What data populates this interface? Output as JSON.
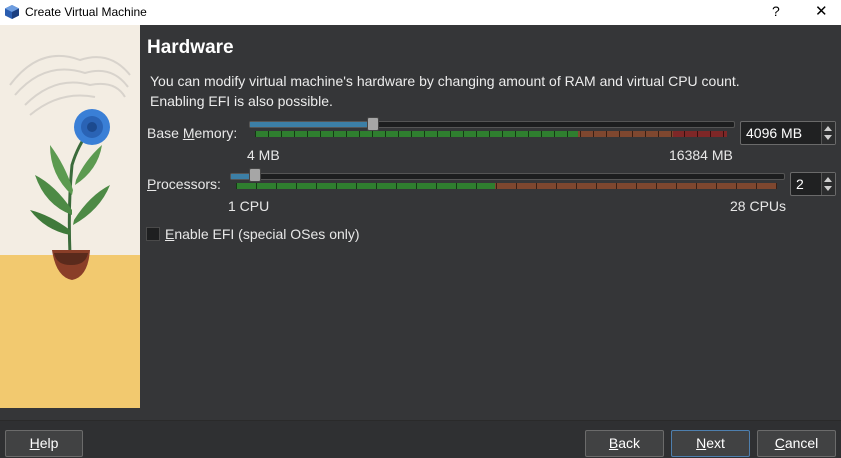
{
  "window": {
    "title": "Create Virtual Machine",
    "help_glyph": "?",
    "close_glyph": "✕"
  },
  "page": {
    "heading": "Hardware",
    "description": "You can modify virtual machine's hardware by changing amount of RAM and virtual CPU count. Enabling EFI is also possible."
  },
  "memory": {
    "label_pre": "Base ",
    "label_accel": "M",
    "label_post": "emory:",
    "min_label": "4 MB",
    "max_label": "16384 MB",
    "value_text": "4096 MB",
    "value": 4096,
    "min": 4,
    "max": 16384
  },
  "processors": {
    "label_accel": "P",
    "label_post": "rocessors:",
    "min_label": "1 CPU",
    "max_label": "28 CPUs",
    "value_text": "2",
    "value": 2,
    "min": 1,
    "max": 28
  },
  "efi": {
    "label_accel": "E",
    "label_post": "nable EFI (special OSes only)",
    "checked": false
  },
  "buttons": {
    "help_accel": "H",
    "help_post": "elp",
    "back_accel": "B",
    "back_post": "ack",
    "next_accel": "N",
    "next_post": "ext",
    "cancel_accel": "C",
    "cancel_post": "ancel"
  },
  "colors": {
    "range_good": "#2e8b2e",
    "range_warn": "#8b4a2e",
    "range_bad": "#8b2424",
    "slider_fill": "#3c7fa6",
    "primary_border": "#4e7fae"
  },
  "icons": {
    "app": "virtualbox-cube-icon",
    "illustration": "potted-blue-flower-illustration"
  }
}
